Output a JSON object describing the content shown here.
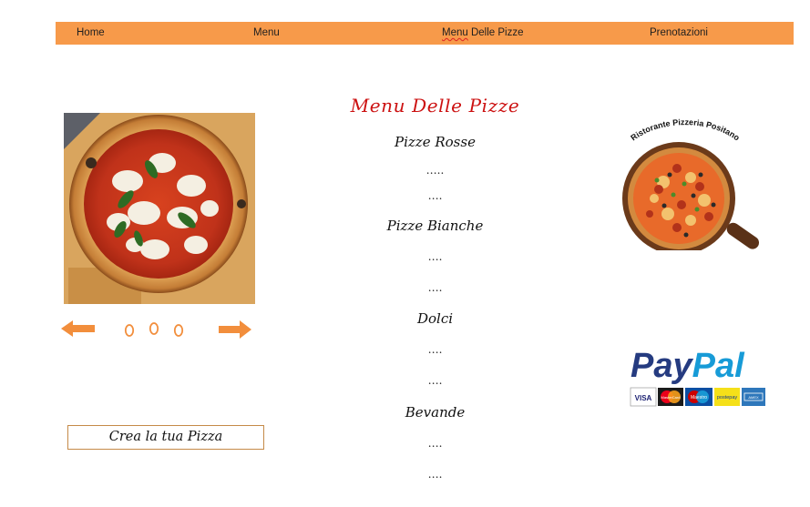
{
  "nav": {
    "items": [
      {
        "label": "Home"
      },
      {
        "label": "Menu"
      },
      {
        "label_underlined": "Menu",
        "label_rest": " Delle Pizze"
      },
      {
        "label": "Prenotazioni"
      }
    ],
    "bar_color": "#f79a4a"
  },
  "carousel": {
    "prev_icon": "arrow-left-icon",
    "next_icon": "arrow-right-icon",
    "dots": [
      "0",
      "0",
      "0"
    ]
  },
  "crea_button": {
    "label": "Crea la tua Pizza"
  },
  "menu": {
    "title": "Menu Delle Pizze",
    "sections": [
      {
        "heading": "Pizze Rosse",
        "items": [
          "…..",
          "…."
        ]
      },
      {
        "heading": "Pizze Bianche",
        "items": [
          "….",
          "…."
        ]
      },
      {
        "heading": "Dolci",
        "items": [
          "….",
          "…."
        ]
      },
      {
        "heading": "Bevande",
        "items": [
          "….",
          "…."
        ]
      }
    ]
  },
  "logo": {
    "text": "Ristorante Pizzeria Positano"
  },
  "payment": {
    "brand": "PayPal",
    "cards": [
      "VISA",
      "MasterCard",
      "Maestro",
      "postepay",
      "AMERICAN EXPRESS"
    ]
  },
  "colors": {
    "accent": "#f79a4a",
    "title_red": "#cc1111",
    "paypal_dark": "#253b80",
    "paypal_light": "#179bd7"
  }
}
